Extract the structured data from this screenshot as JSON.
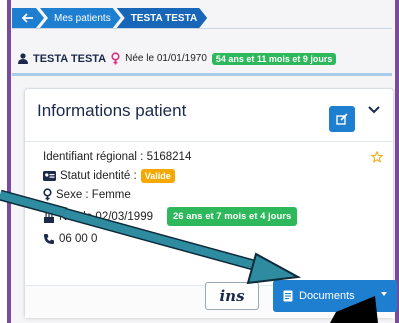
{
  "breadcrumb": {
    "items": [
      {
        "label": "",
        "icon": "back-arrow-icon"
      },
      {
        "label": "Mes patients"
      },
      {
        "label": "TESTA TESTA"
      }
    ]
  },
  "patient_header": {
    "name": "TESTA TESTA",
    "born": "Née le 01/01/1970",
    "age_badge": "54 ans et 11 mois et 9 jours"
  },
  "card": {
    "title": "Informations patient",
    "regional_id": "Identifiant régional : 5168214",
    "identity_status_label": "Statut identité :",
    "identity_status_value": "Valide",
    "sex": "Sexe : Femme",
    "birth": "Née le 02/03/1999",
    "age": "26 ans et 7 mois et 4 jours",
    "phone": "06 00 0"
  },
  "footer": {
    "ins_label": "ins",
    "documents_label": "Documents"
  },
  "colors": {
    "primary": "#1e7fd0",
    "green": "#2eb85c",
    "orange": "#f5a800",
    "frame": "#7a4a9c",
    "annotation_arrow": "#2f8ca0"
  }
}
